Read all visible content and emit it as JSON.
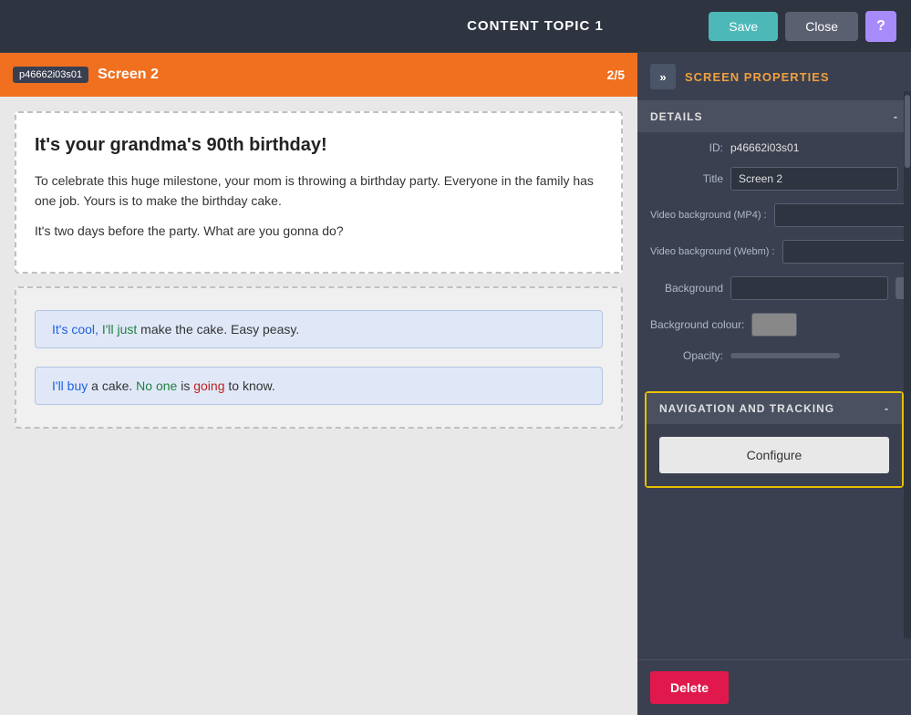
{
  "header": {
    "title": "CONTENT TOPIC 1",
    "save_label": "Save",
    "close_label": "Close",
    "help_label": "?"
  },
  "screen_bar": {
    "id_badge": "p46662i03s01",
    "title": "Screen 2",
    "counter": "2/5"
  },
  "text_card": {
    "heading": "It's your grandma's 90th birthday!",
    "para1": "To celebrate this huge milestone, your mom is throwing a birthday party. Everyone in the family has one job. Yours is to make the birthday cake.",
    "para2": "It's two days before the party. What are you gonna do?"
  },
  "choices": [
    {
      "text": "It's cool, I'll just make the cake. Easy peasy."
    },
    {
      "text": "I'll buy a cake. No one is going to know."
    }
  ],
  "right_panel": {
    "title": "SCREEN PROPERTIES",
    "collapse_icon": "»",
    "details_label": "DETAILS",
    "collapse_details": "-",
    "id_label": "ID:",
    "id_value": "p46662i03s01",
    "title_label": "Title",
    "title_value": "Screen 2",
    "video_bg_mp4_label": "Video background (MP4) :",
    "video_bg_webm_label": "Video background (Webm) :",
    "background_label": "Background",
    "bg_colour_label": "Background colour:",
    "opacity_label": "Opacity:",
    "nav_tracking_label": "NAVIGATION AND TRACKING",
    "collapse_nav": "-",
    "configure_label": "Configure",
    "delete_label": "Delete"
  },
  "colors": {
    "orange": "#f07020",
    "teal": "#4db8b8",
    "purple": "#a78bfa",
    "yellow_border": "#e8c000",
    "delete_red": "#e0184c"
  }
}
